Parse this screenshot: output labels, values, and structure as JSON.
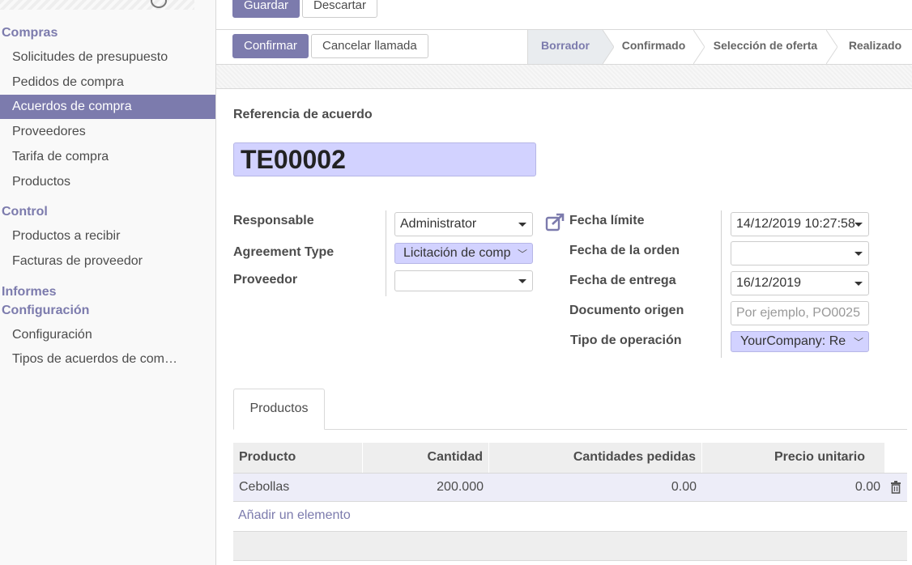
{
  "sidebar": {
    "sections": [
      {
        "title": "Compras",
        "items": [
          "Solicitudes de presupuesto",
          "Pedidos de compra",
          "Acuerdos de compra",
          "Proveedores",
          "Tarifa de compra",
          "Productos"
        ]
      },
      {
        "title": "Control",
        "items": [
          "Productos a recibir",
          "Facturas de proveedor"
        ]
      },
      {
        "title": "Informes",
        "items": []
      },
      {
        "title": "Configuración",
        "items": [
          "Configuración",
          "Tipos de acuerdos de com…"
        ]
      }
    ],
    "active_item": "Acuerdos de compra"
  },
  "toolbar": {
    "save_label": "Guardar",
    "discard_label": "Descartar"
  },
  "actions": {
    "confirm_label": "Confirmar",
    "cancel_label": "Cancelar llamada"
  },
  "status": {
    "stages": [
      "Borrador",
      "Confirmado",
      "Selección de oferta",
      "Realizado"
    ],
    "current": "Borrador"
  },
  "form": {
    "ref_label": "Referencia de acuerdo",
    "ref_value": "TE00002",
    "responsable_label": "Responsable",
    "responsable_value": "Administrator",
    "agreement_type_label": "Agreement Type",
    "agreement_type_value": "Licitación de comp",
    "proveedor_label": "Proveedor",
    "proveedor_value": "",
    "fecha_limite_label": "Fecha límite",
    "fecha_limite_value": "14/12/2019 10:27:58",
    "fecha_orden_label": "Fecha de la orden",
    "fecha_orden_value": "",
    "fecha_entrega_label": "Fecha de entrega",
    "fecha_entrega_value": "16/12/2019",
    "doc_origen_label": "Documento origen",
    "doc_origen_placeholder": "Por ejemplo, PO0025",
    "tipo_operacion_label": "Tipo de operación",
    "tipo_operacion_value": "YourCompany: Re"
  },
  "tabs": {
    "productos_label": "Productos"
  },
  "table": {
    "columns": [
      "Producto",
      "Cantidad",
      "Cantidades pedidas",
      "Precio unitario"
    ],
    "rows": [
      {
        "producto": "Cebollas",
        "cantidad": "200.000",
        "pedidas": "0.00",
        "precio": "0.00"
      }
    ],
    "add_label": "Añadir un elemento"
  },
  "colors": {
    "accent": "#7c7bad",
    "required_field": "#d2d2ff"
  }
}
